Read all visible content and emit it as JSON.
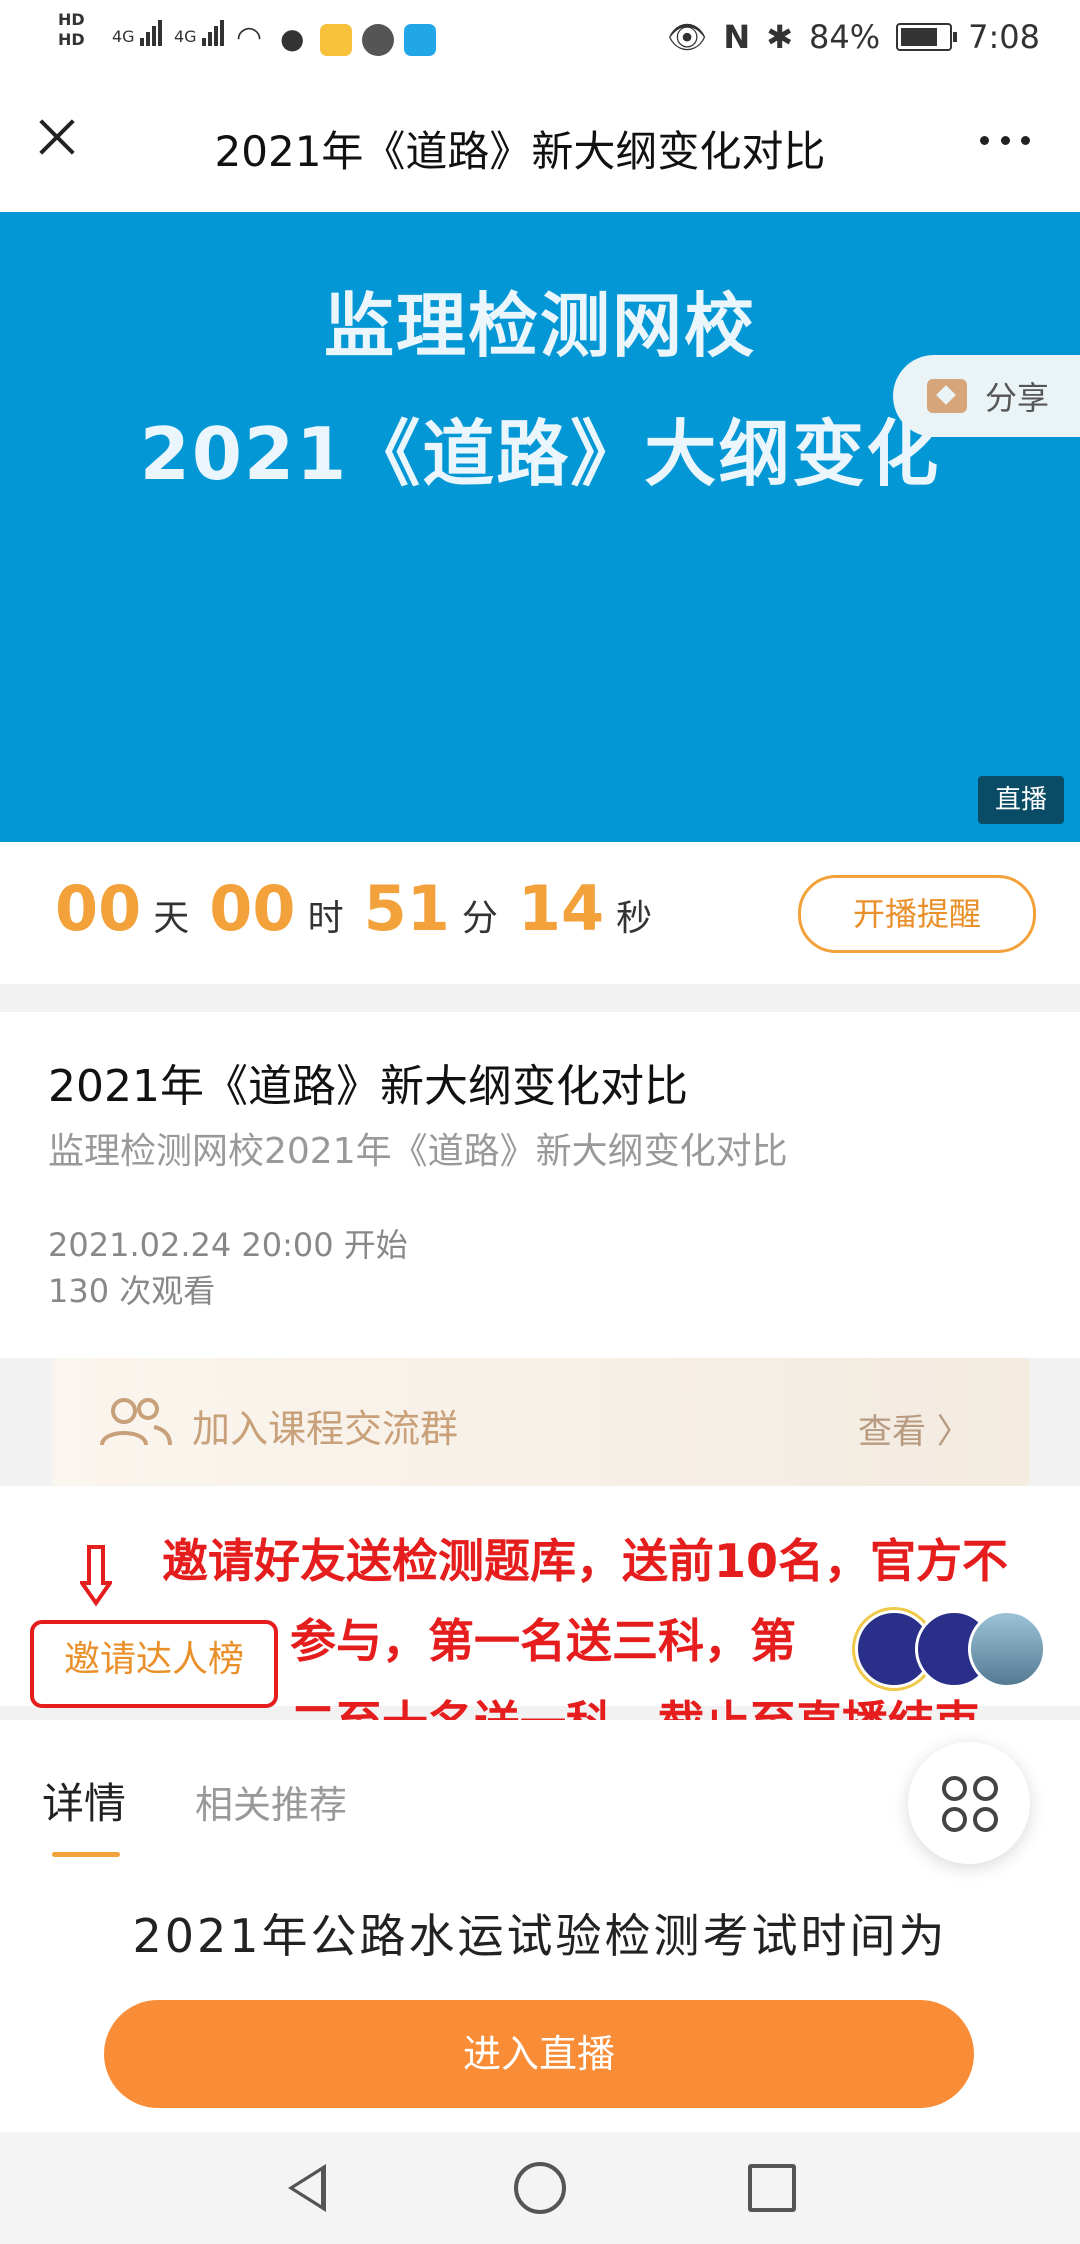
{
  "status_bar": {
    "hd1": "HD",
    "hd2": "HD",
    "sim1": "4G",
    "sim2": "4G",
    "battery": "84%",
    "time": "7:08"
  },
  "header": {
    "title": "2021年《道路》新大纲变化对比"
  },
  "banner": {
    "line1": "监理检测网校",
    "line2": "2021《道路》大纲变化",
    "share_label": "分享",
    "live_tag": "直播"
  },
  "countdown": {
    "days": "00",
    "days_unit": "天",
    "hours": "00",
    "hours_unit": "时",
    "minutes": "51",
    "minutes_unit": "分",
    "seconds": "14",
    "seconds_unit": "秒",
    "remind_label": "开播提醒"
  },
  "info": {
    "title": "2021年《道路》新大纲变化对比",
    "subtitle": "监理检测网校2021年《道路》新大纲变化对比",
    "start_time": "2021.02.24 20:00 开始",
    "views": "130 次观看"
  },
  "group": {
    "label": "加入课程交流群",
    "view": "查看 〉"
  },
  "invite": {
    "label": "邀请达人榜",
    "annotation_line1": "邀请好友送检测题库，送前10名，官方不",
    "annotation_line2": "参与，第一名送三科，第",
    "annotation_line3": "二至十名送一科，截止至直播结束"
  },
  "tabs": {
    "details": "详情",
    "related": "相关推荐"
  },
  "detail_text": "2021年公路水运试验检测考试时间为",
  "enter_button": "进入直播",
  "colors": {
    "accent": "#f3a13b",
    "banner": "#0497d6",
    "annotation": "#e51d1d",
    "button": "#f98c36"
  },
  "icons": [
    "close-icon",
    "more-icon",
    "share-icon",
    "group-icon",
    "grid-icon",
    "nav-back-icon",
    "nav-home-icon",
    "nav-recent-icon"
  ]
}
